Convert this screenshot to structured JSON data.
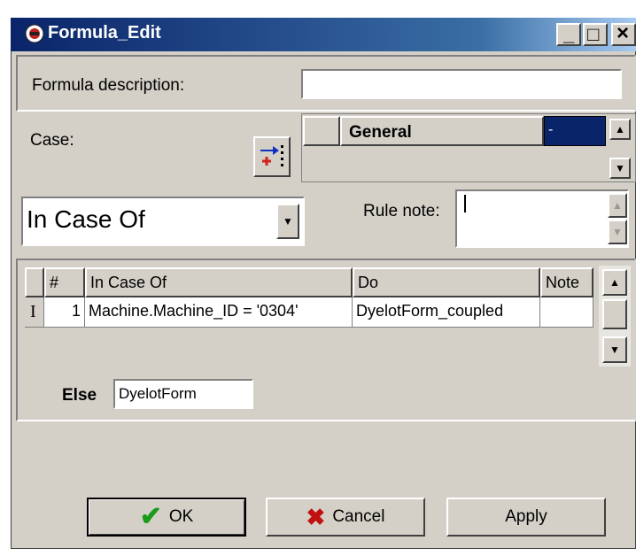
{
  "window": {
    "title": "Formula_Edit",
    "min_glyph": "_",
    "max_glyph": "□",
    "close_glyph": "×"
  },
  "form": {
    "desc_label": "Formula description:",
    "desc_value": "",
    "case_label": "Case:",
    "mode_select": "In Case Of",
    "rule_note_label": "Rule note:",
    "rule_note_value": ""
  },
  "general_grid": {
    "header": "General",
    "selected_value": "-"
  },
  "case_table": {
    "columns": [
      "#",
      "In Case Of",
      "Do",
      "Note"
    ],
    "rows": [
      {
        "indicator": "I",
        "num": "1",
        "condition": "Machine.Machine_ID = '0304'",
        "action": "DyelotForm_coupled",
        "note": ""
      }
    ]
  },
  "else": {
    "label": "Else",
    "value": "DyelotForm"
  },
  "buttons": {
    "ok": "OK",
    "cancel": "Cancel",
    "apply": "Apply"
  },
  "colors": {
    "titlebar": "#0a246a",
    "face": "#d4d0c8",
    "selection": "#0a246a",
    "ok_check": "#1a9a1a",
    "cancel_x": "#c01010"
  }
}
